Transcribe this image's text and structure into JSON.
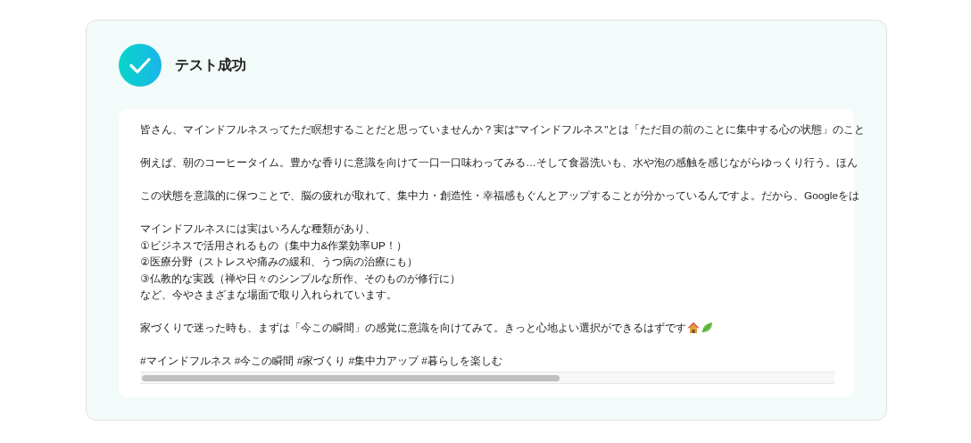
{
  "result": {
    "title": "テスト成功",
    "kind": "success",
    "paragraphs": [
      [
        "皆さん、マインドフルネスってただ瞑想することだと思っていませんか？実は\"マインドフルネス\"とは「ただ目の前のことに集中する心の状態」のこと"
      ],
      [
        "例えば、朝のコーヒータイム。豊かな香りに意識を向けて一口一口味わってみる…そして食器洗いも、水や泡の感触を感じながらゆっくり行う。ほん"
      ],
      [
        "この状態を意識的に保つことで、脳の疲れが取れて、集中力・創造性・幸福感もぐんとアップすることが分かっているんですよ。だから、Googleをは"
      ],
      [
        "マインドフルネスには実はいろんな種類があり、",
        "①ビジネスで活用されるもの（集中力&作業効率UP！）",
        "②医療分野（ストレスや痛みの緩和、うつ病の治療にも）",
        "③仏教的な実践（禅や日々のシンプルな所作、そのものが修行に）",
        "など、今やさまざまな場面で取り入れられています。"
      ],
      [
        "家づくりで迷った時も、まずは「今この瞬間」の感覚に意識を向けてみて。きっと心地よい選択ができるはずです"
      ],
      [
        "#マインドフルネス #今この瞬間 #家づくり #集中力アップ #暮らしを楽しむ"
      ]
    ]
  }
}
